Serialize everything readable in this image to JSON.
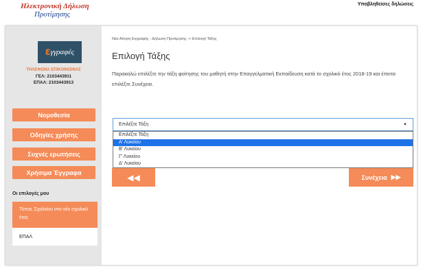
{
  "brand": {
    "line1": "Ηλεκτρονική Δήλωση",
    "line2": "Προτίμησης"
  },
  "top_link": "Υποβληθείσες δηλώσεις",
  "sidebar": {
    "logo_text": "γγραφές",
    "logo_letter": "ε",
    "contact_title": "ΤΗΛΕΦΩΝΑ ΕΠΙΚΟΙΝΩΝΙΑΣ",
    "contact_gel": "ΓΕΛ: 2103443911",
    "contact_epal": "ΕΠΑΛ: 2103443913",
    "buttons": [
      "Νομοθεσία",
      "Οδηγίες χρήσης",
      "Συχνές ερωτήσεις",
      "Χρήσιμα Έγγραφα"
    ],
    "section_title": "Οι επιλογές μου",
    "choice_label": "Τύπος Σχολείου στο νέο σχολικό έτος",
    "choice_value": "ΕΠΑΛ"
  },
  "main": {
    "breadcrumb": "Νέα Αίτηση Εγγραφής - Δήλωση Προτίμησης -> Επιλογή Τάξης",
    "title": "Επιλογή Τάξης",
    "instructions": "Παρακαλώ επιλέξτε την τάξη φοίτησης του μαθητή στην Επαγγελματική Εκπαίδευση κατά το σχολικό έτος 2018-19 και έπειτα επιλέξτε Συνέχεια.",
    "select": {
      "current": "Επιλέξτε Τάξη",
      "options": [
        "Επιλέξτε Τάξη",
        "Α' Λυκείου",
        "Β' Λυκείου",
        "Γ' Λυκείου",
        "Δ' Λυκείου"
      ],
      "highlighted_index": 1
    },
    "back_icon": "double-chevron-left-icon",
    "back_glyph": "◀◀",
    "next_label": "Συνέχεια",
    "next_glyph": "▶▶"
  },
  "colors": {
    "accent": "#f48b58",
    "highlight": "#1e72e8",
    "sidebar_bg": "#e6e6e6"
  }
}
